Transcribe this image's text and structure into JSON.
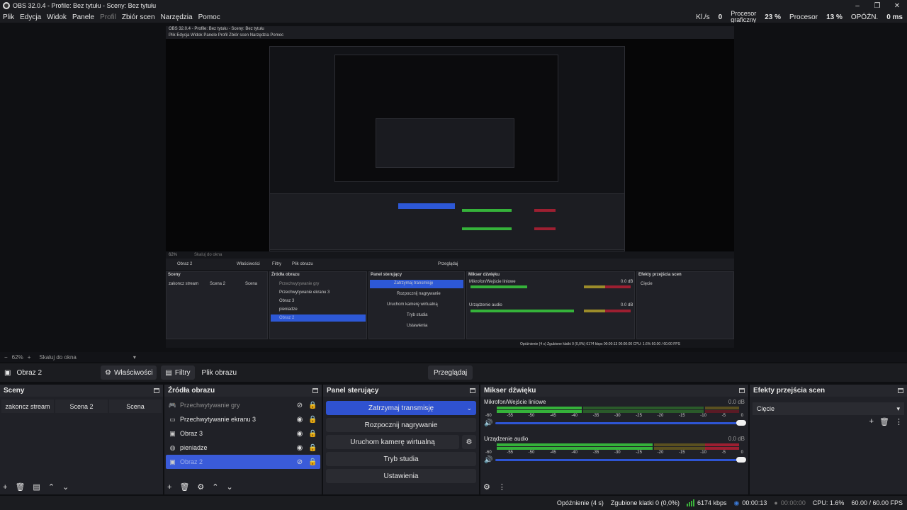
{
  "window": {
    "title": "OBS 32.0.4 - Profile: Bez tytułu - Sceny: Bez tytułu",
    "minimize": "–",
    "maximize": "❐",
    "close": "✕"
  },
  "menu": [
    "Plik",
    "Edycja",
    "Widok",
    "Panele",
    "Profil",
    "Zbiór scen",
    "Narzędzia",
    "Pomoc"
  ],
  "stats": {
    "kbs_label": "Kl./s",
    "kbs_value": "0",
    "gpu_label_1": "Procesor",
    "gpu_label_2": "graficzny",
    "gpu_value": "23 %",
    "cpu_label": "Procesor",
    "cpu_value": "13 %",
    "delay_label": "OPÓŹN.",
    "delay_value": "0 ms"
  },
  "preview_nested": {
    "title": "OBS 32.0.4 - Profile: Bez tytułu - Sceny: Bez tytułu",
    "menu": "Plik   Edycja   Widok   Panele   Profil   Zbiór scen   Narzędzia   Pomoc",
    "source": "Obraz 2",
    "props": "Właściwości",
    "filters": "Filtry",
    "file": "Plik obrazu",
    "preview": "Przeglądaj",
    "scenes_title": "Sceny",
    "sources_title": "Źródła obrazu",
    "controls_title": "Panel sterujący",
    "mixer_title": "Mikser dźwięku",
    "transitions_title": "Efekty przejścia scen",
    "scene_1": "zakoncz stream",
    "scene_2": "Scena 2",
    "scene_3": "Scena",
    "src_1": "Przechwytywanie gry",
    "src_2": "Przechwytywanie ekranu 3",
    "src_3": "Obraz 3",
    "src_4": "pieniadze",
    "src_5": "Obraz 2",
    "btn_1": "Zatrzymaj transmisję",
    "btn_2": "Rozpocznij nagrywanie",
    "btn_3": "Uruchom kamerę wirtualną",
    "btn_4": "Tryb studia",
    "btn_5": "Ustawienia",
    "mic": "Mikrofon/Wejście liniowe",
    "audio": "Urządzenie audio",
    "db": "0.0 dB",
    "transition": "Cięcie",
    "zoom": "62%",
    "scale": "Skaluj do okna",
    "status": "Opóźnienie (4 s)   Zgubione klatki 0 (0,0%)   6174 kbps   00:00:13   00:00:00   CPU: 1.6%   60.00 / 60.00 FPS"
  },
  "zoombar": {
    "minus": "−",
    "zoom": "62%",
    "plus": "+",
    "scale": "Skaluj do okna"
  },
  "context": {
    "source_name": "Obraz 2",
    "properties": "Właściwości",
    "filters": "Filtry",
    "image_file": "Plik obrazu",
    "browse": "Przeglądaj"
  },
  "scenes": {
    "title": "Sceny",
    "items": [
      "zakoncz stream",
      "Scena 2",
      "Scena"
    ]
  },
  "sources": {
    "title": "Źródła obrazu",
    "items": [
      {
        "name": "Przechwytywanie gry",
        "icon": "gamepad-icon",
        "hidden": true
      },
      {
        "name": "Przechwytywanie ekranu 3",
        "icon": "monitor-icon",
        "hidden": false
      },
      {
        "name": "Obraz 3",
        "icon": "image-icon",
        "hidden": false
      },
      {
        "name": "pieniadze",
        "icon": "browser-icon",
        "hidden": false
      },
      {
        "name": "Obraz 2",
        "icon": "image-icon",
        "hidden": true,
        "selected": true
      }
    ]
  },
  "controls": {
    "title": "Panel sterujący",
    "stop_stream": "Zatrzymaj transmisję",
    "start_record": "Rozpocznij nagrywanie",
    "virtual_cam": "Uruchom kamerę wirtualną",
    "studio_mode": "Tryb studia",
    "settings": "Ustawienia"
  },
  "mixer": {
    "title": "Mikser dźwięku",
    "channels": [
      {
        "name": "Mikrofon/Wejście liniowe",
        "db": "0.0 dB"
      },
      {
        "name": "Urządzenie audio",
        "db": "0.0 dB"
      }
    ],
    "scale": [
      "-60",
      "-55",
      "-50",
      "-45",
      "-40",
      "-35",
      "-30",
      "-25",
      "-20",
      "-15",
      "-10",
      "-5",
      "0"
    ]
  },
  "transitions": {
    "title": "Efekty przejścia scen",
    "selected": "Cięcie"
  },
  "status": {
    "delay": "Opóźnienie (4 s)",
    "dropped": "Zgubione klatki 0 (0,0%)",
    "kbps": "6174 kbps",
    "stream_time": "00:00:13",
    "rec_time": "00:00:00",
    "cpu": "CPU: 1.6%",
    "fps": "60.00 / 60.00 FPS"
  },
  "colors": {
    "accent": "#2f52d0",
    "meter_green": "#35b23a",
    "meter_yellow": "#9c8c2a",
    "meter_red": "#9d1f31"
  }
}
